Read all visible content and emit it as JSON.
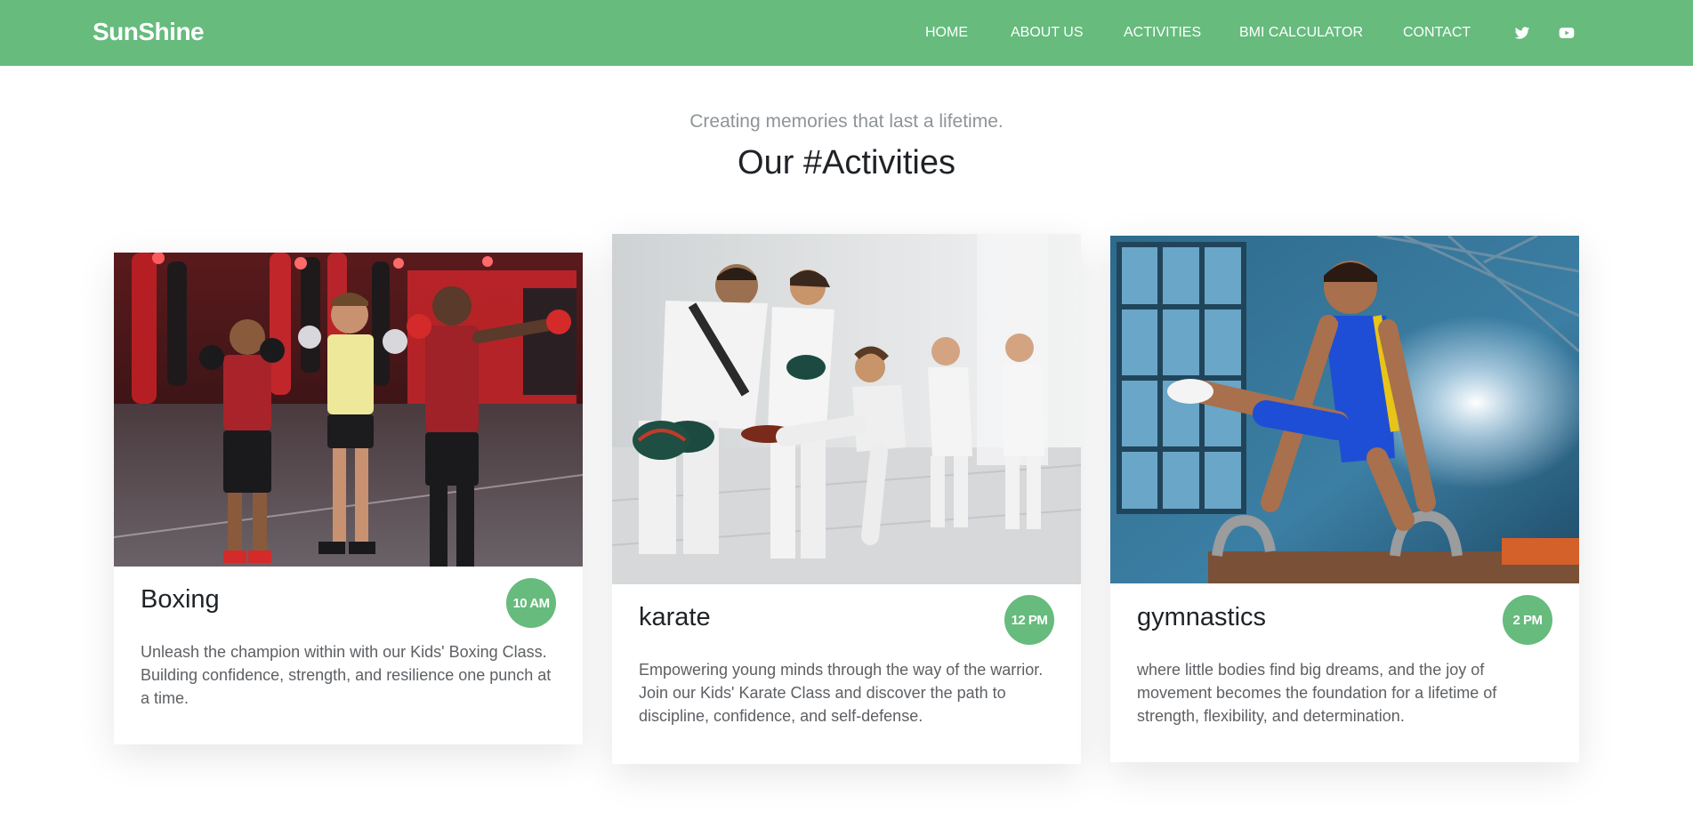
{
  "brand": {
    "name": "SunShine"
  },
  "colors": {
    "accent": "#66bb7d",
    "title": "#1f2226",
    "subtitle": "#8f9497",
    "body_text": "#5d6064"
  },
  "nav": {
    "items": [
      {
        "label": "HOME"
      },
      {
        "label": "ABOUT US"
      },
      {
        "label": "ACTIVITIES"
      },
      {
        "label": "BMI CALCULATOR"
      },
      {
        "label": "CONTACT"
      }
    ],
    "social": [
      {
        "icon": "twitter-icon"
      },
      {
        "icon": "youtube-icon"
      }
    ]
  },
  "section": {
    "subtitle": "Creating memories that last a lifetime.",
    "title": "Our #Activities"
  },
  "activities": [
    {
      "name": "Boxing",
      "time": "10 AM",
      "description": "Unleash the champion within with our Kids' Boxing Class. Building confidence, strength, and resilience one punch at a time.",
      "photo_icon": "boxing-kids-photo"
    },
    {
      "name": "karate",
      "time": "12 PM",
      "description": "Empowering young minds through the way of the warrior. Join our Kids' Karate Class and discover the path to discipline, confidence, and self-defense.",
      "photo_icon": "karate-class-photo"
    },
    {
      "name": "gymnastics",
      "time": "2 PM",
      "description": "where little bodies find big dreams, and the joy of movement becomes the foundation for a lifetime of strength, flexibility, and determination.",
      "photo_icon": "gymnastics-boy-photo"
    }
  ]
}
